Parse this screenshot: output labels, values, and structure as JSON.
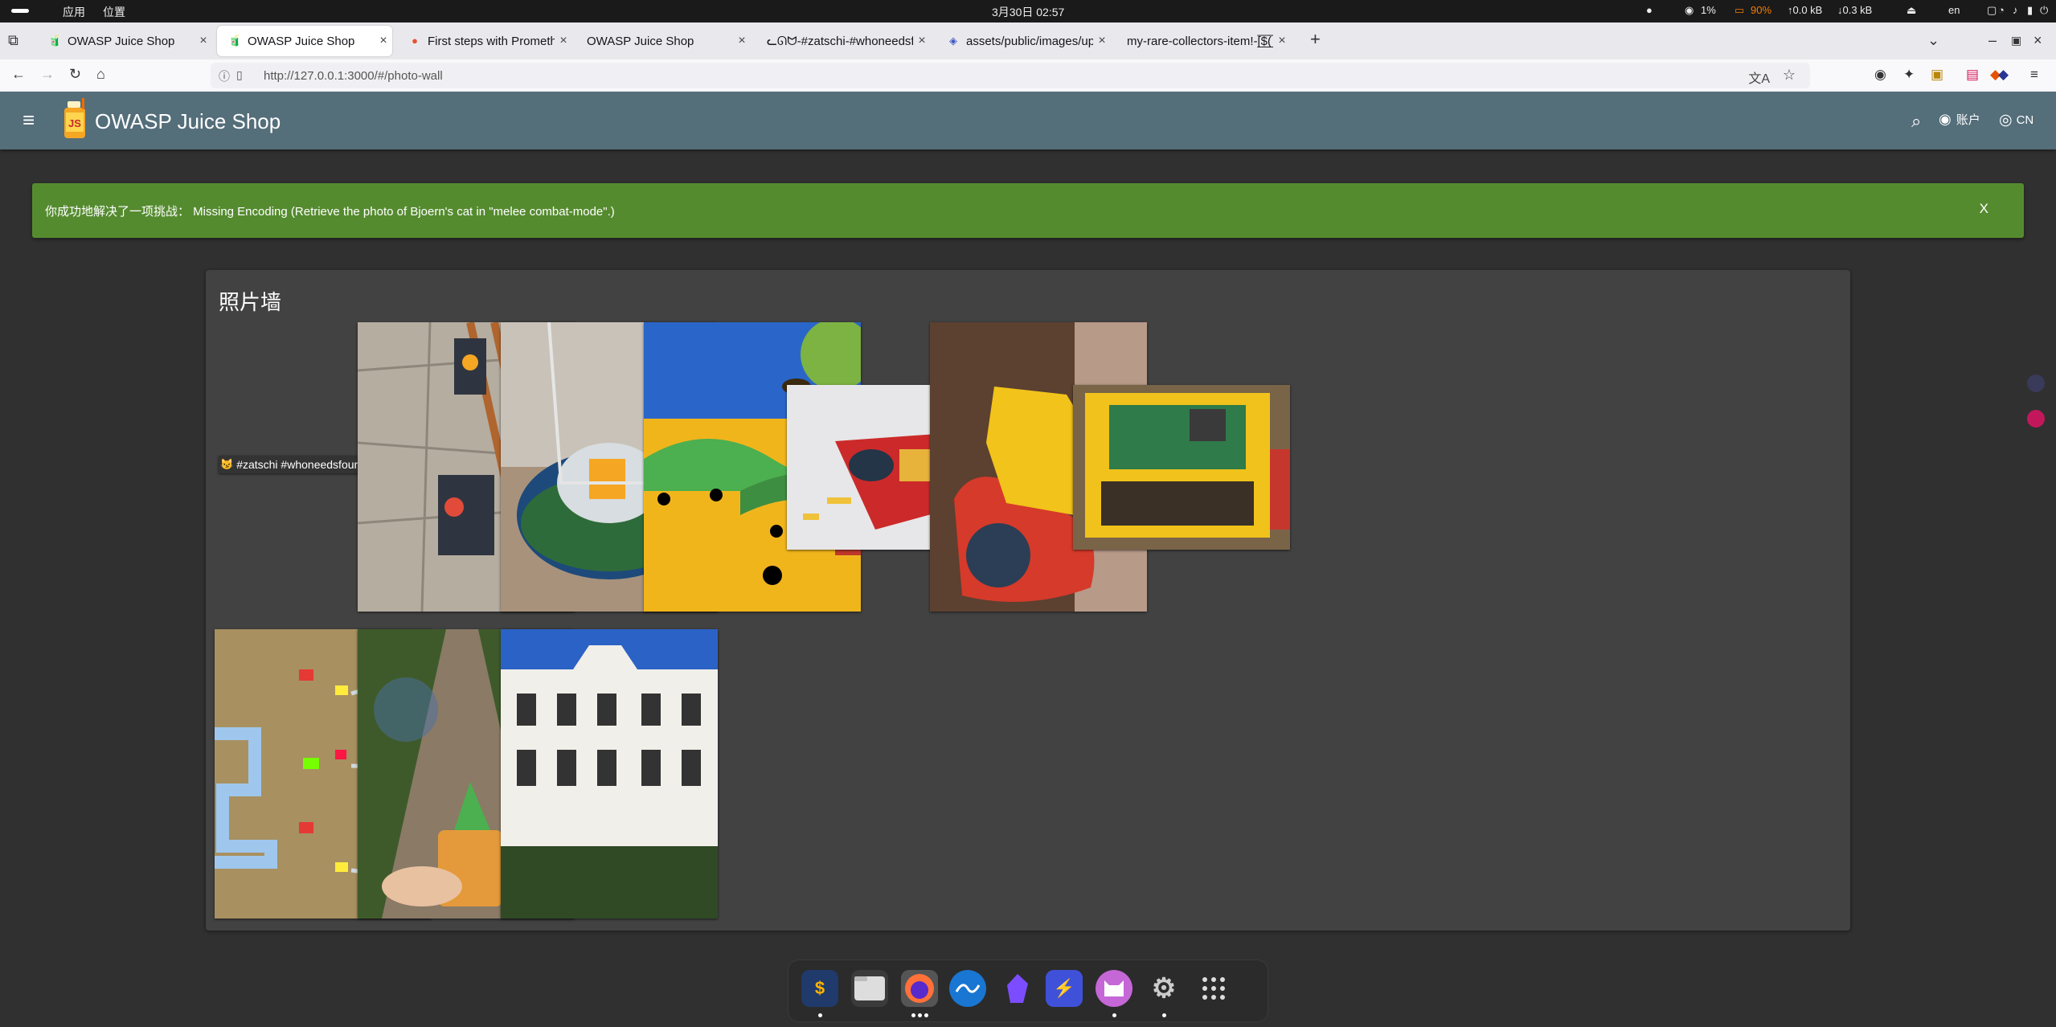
{
  "system_bar": {
    "menu_apps": "应用",
    "menu_places": "位置",
    "clock": "3月30日 02:57",
    "cpu": "1%",
    "battery": "90%",
    "net_up": "↑0.0 kB",
    "net_down": "↓0.3 kB",
    "lang": "en"
  },
  "tabs": [
    {
      "title": "OWASP Juice Shop",
      "icon": "juice-shop-favicon"
    },
    {
      "title": "OWASP Juice Shop",
      "icon": "juice-shop-favicon"
    },
    {
      "title": "First steps with Promethe",
      "icon": "prometheus-favicon"
    },
    {
      "title": "OWASP Juice Shop",
      "icon": "none"
    },
    {
      "title": "ᓚᘏᗢ-#zatschi-#whoneedsf",
      "icon": "none"
    },
    {
      "title": "assets/public/images/upl",
      "icon": "image-favicon"
    },
    {
      "title": "my-rare-collectors-item!-[̲̅$̲̅(̲̅",
      "icon": "none"
    }
  ],
  "address_bar": {
    "url": "http://127.0.0.1:3000/#/photo-wall"
  },
  "app": {
    "title": "OWASP Juice Shop",
    "account_label": "账户",
    "language_label": "CN"
  },
  "notification": {
    "message": "你成功地解决了一项挑战： Missing Encoding (Retrieve the photo of Bjoern's cat in \"melee combat-mode\".)",
    "close_label": "X"
  },
  "photo_wall": {
    "title": "照片墙",
    "broken_caption": "#zatschi #whoneedsfourlegs",
    "broken_caption_icon": "cat-emoji-icon",
    "photos": [
      {
        "subject": "stickers-on-stone-wall"
      },
      {
        "subject": "juice-shop-glass-on-coaster"
      },
      {
        "subject": "cartoon-bees-landscape"
      },
      {
        "subject": "lego-bricks-on-table"
      },
      {
        "subject": "lego-yellow-box-on-red-plate"
      },
      {
        "subject": "raspberry-pi-in-lego-case"
      },
      {
        "subject": "lego-server-rack-with-cables"
      },
      {
        "subject": "drink-on-forest-path"
      },
      {
        "subject": "white-building-facade"
      }
    ]
  },
  "dock": {
    "apps": [
      "terminal-icon",
      "files-icon",
      "firefox-icon",
      "wireshark-icon",
      "obsidian-icon",
      "bolt-icon",
      "cat-app-icon",
      "settings-icon",
      "app-grid-icon"
    ]
  },
  "colors": {
    "toolbar": "#546e7a",
    "success": "#558b2f",
    "card": "#424242",
    "background": "#303030"
  }
}
